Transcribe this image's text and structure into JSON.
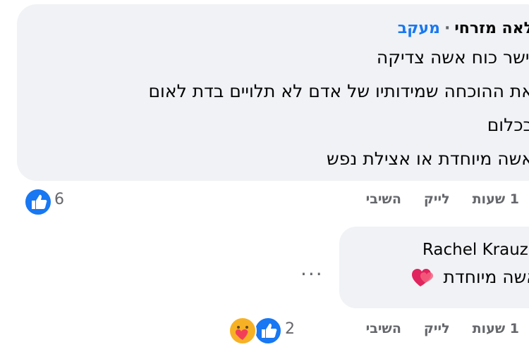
{
  "comments": [
    {
      "author": "לאה מזרחי",
      "separator": "·",
      "follow_label": "מעקב",
      "lines": [
        "יישר כוח אשה צדיקה",
        "את ההוכחה שמידותיו של אדם לא תלויים בדת לאום",
        "בכלום",
        "אשה מיוחדת או אצילת נפש"
      ],
      "time": "1 שעות",
      "like_label": "לייק",
      "reply_label": "השיבי",
      "reaction_count": "6",
      "reactions": [
        "like-icon"
      ]
    },
    {
      "author": "Rachel Krauze",
      "lines": [
        "אשה מיוחדת"
      ],
      "emoji": "heart-emoji",
      "time": "1 שעות",
      "like_label": "לייק",
      "reply_label": "השיבי",
      "reaction_count": "2",
      "reactions": [
        "like-icon",
        "care-icon"
      ],
      "more_label": "..."
    }
  ],
  "colors": {
    "bubble": "#f0f2f5",
    "follow": "#1877f2",
    "meta": "#65676b",
    "like": "#1877f2"
  }
}
